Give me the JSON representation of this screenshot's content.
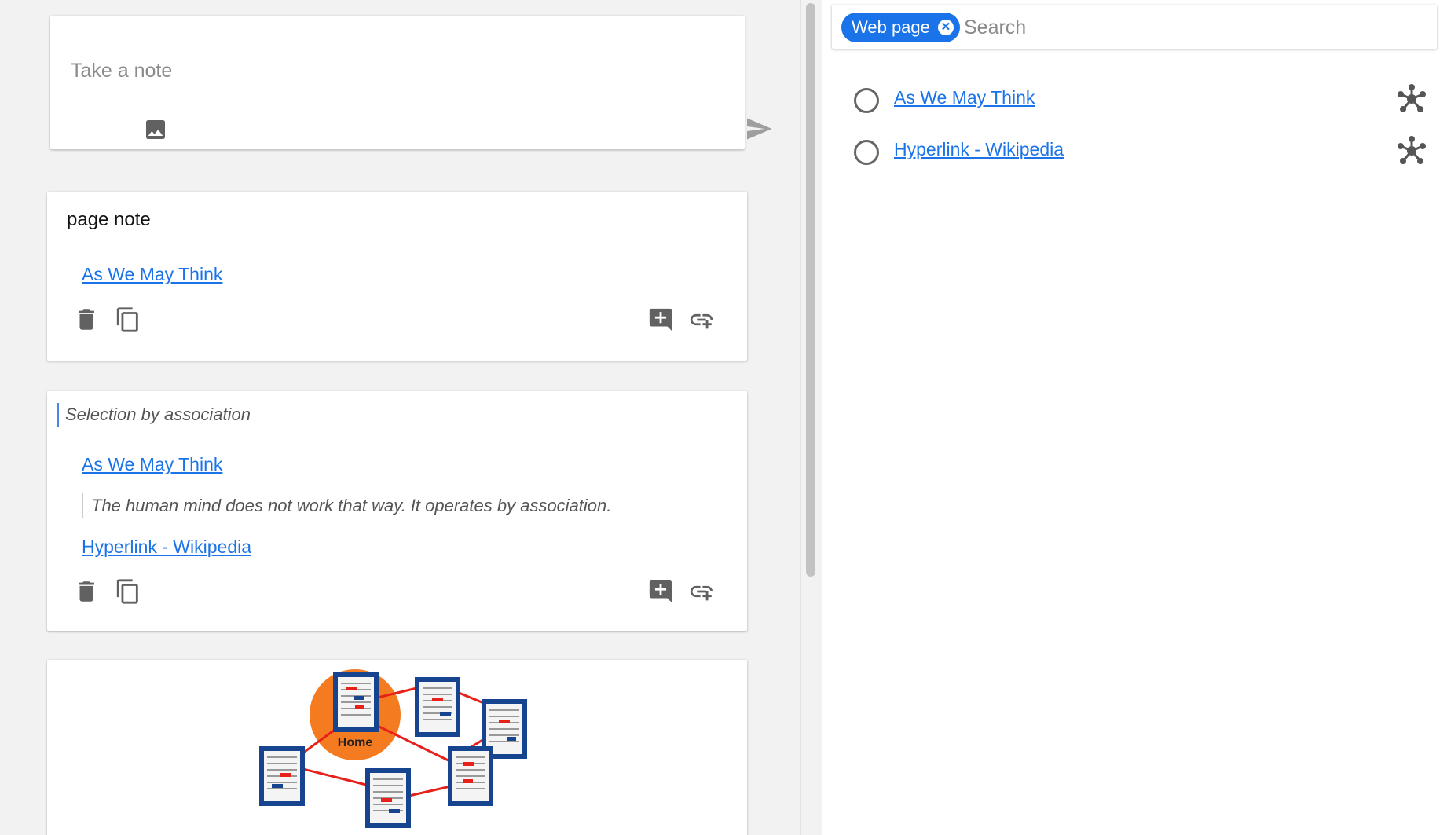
{
  "composer": {
    "placeholder": "Take a note",
    "image_icon": "image-icon",
    "send_icon": "send-icon"
  },
  "notes": [
    {
      "title": "page note",
      "links": [
        "As We May Think"
      ],
      "actions": [
        "delete-icon",
        "copy-icon",
        "add-comment-icon",
        "add-link-icon"
      ]
    },
    {
      "title": "Selection by association",
      "links": [
        "As We May Think",
        "Hyperlink - Wikipedia"
      ],
      "quote": "The human mind does not work that way. It operates by association.",
      "actions": [
        "delete-icon",
        "copy-icon",
        "add-comment-icon",
        "add-link-icon"
      ]
    },
    {
      "image_label": "Home"
    }
  ],
  "search": {
    "chip_label": "Web page",
    "chip_remove_icon": "close-circle-icon",
    "placeholder": "Search"
  },
  "results": [
    {
      "label": "As We May Think",
      "icon": "graph-icon"
    },
    {
      "label": "Hyperlink - Wikipedia",
      "icon": "graph-icon"
    }
  ],
  "colors": {
    "accent": "#1a73e8",
    "icon_gray": "#616161",
    "background": "#f2f2f2"
  }
}
